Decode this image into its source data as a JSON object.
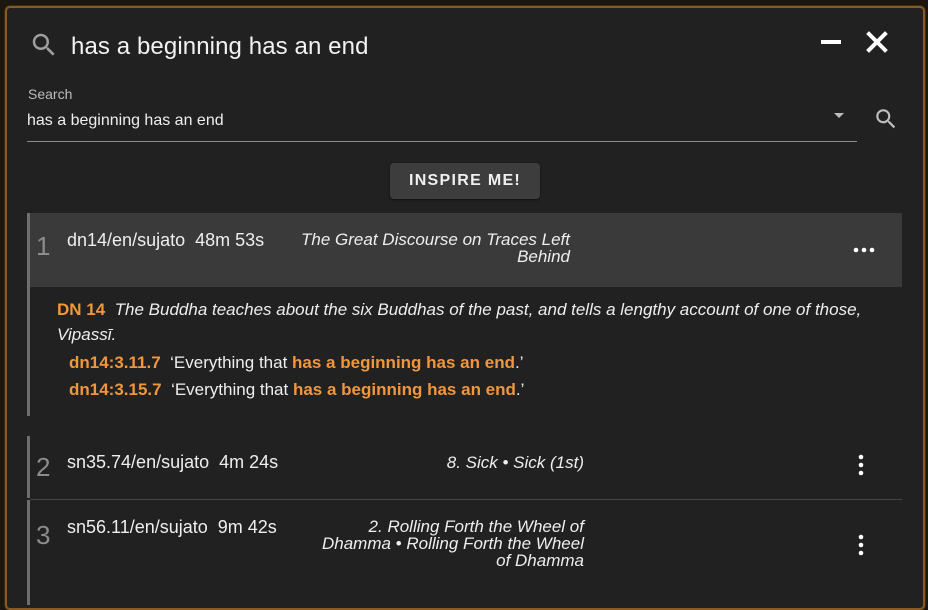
{
  "header": {
    "title": "has a beginning has an end"
  },
  "search": {
    "label": "Search",
    "value": "has a beginning has an end"
  },
  "inspire_button": "INSPIRE ME!",
  "results": [
    {
      "num": "1",
      "ref": "dn14/en/sujato  48m 53s",
      "title": "The Great Discourse on Traces Left Behind",
      "blurb": {
        "code": "DN 14",
        "text": "The Buddha teaches about the six Buddhas of the past, and tells a lengthy account of one of those, Vipassī."
      },
      "segments": [
        {
          "id": "dn14:3.11.7",
          "pre": "‘Everything that ",
          "match": "has a beginning has an end",
          "post": ".’"
        },
        {
          "id": "dn14:3.15.7",
          "pre": "‘Everything that ",
          "match": "has a beginning has an end",
          "post": ".’"
        }
      ]
    },
    {
      "num": "2",
      "ref": "sn35.74/en/sujato  4m 24s",
      "title": "8. Sick • Sick (1st)"
    },
    {
      "num": "3",
      "ref": "sn56.11/en/sujato  9m 42s",
      "title": "2. Rolling Forth the Wheel of Dhamma • Rolling Forth the Wheel of Dhamma"
    }
  ],
  "colors": {
    "accent": "#f0963c",
    "frame": "#8a5a22",
    "background": "#212121"
  }
}
